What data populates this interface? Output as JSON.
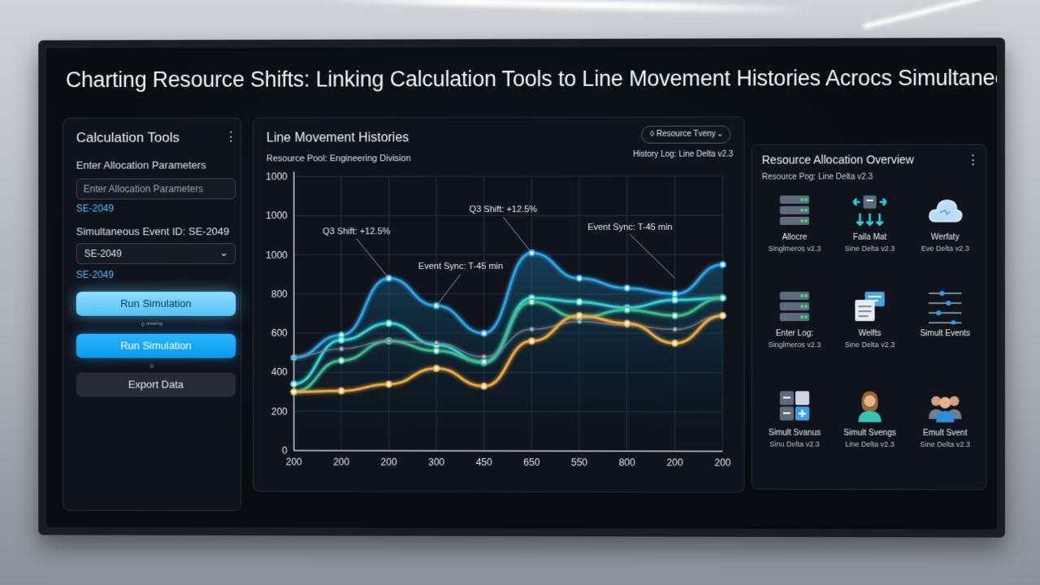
{
  "page_title": "Charting Resource Shifts: Linking Calculation Tools to Line Movement Histories Acrocs Simultaneous E.",
  "left_panel": {
    "title": "Calculation Tools",
    "alloc_label": "Enter Allocation Parameters",
    "alloc_placeholder": "Enter Allocation Parameters",
    "alloc_value": "SE-2049",
    "event_label": "Simultaneous Event ID: SE-2049",
    "event_select": "SE-2049",
    "event_value": "SE-2049",
    "run_primary": "Run Simulation",
    "tiny_caption": "◊ ᵒʳᵉᵃᵗⁱⁿᵍ",
    "run_secondary": "Run Simulation",
    "tiny_mark": "◊",
    "export": "Export Data"
  },
  "center_panel": {
    "title": "Line Movement Histories",
    "subtitle": "Resource Pool: Engineering Division",
    "dropdown": "◊ Resource Tveny",
    "history_log": "History Log: Line Delta v2.3"
  },
  "chart_data": {
    "type": "line",
    "x_tick_labels": [
      "200",
      "200",
      "200",
      "300",
      "450",
      "650",
      "550",
      "800",
      "200",
      "200"
    ],
    "y_tick_labels": [
      "0",
      "200",
      "400",
      "600",
      "800",
      "1000",
      "1000",
      "1000"
    ],
    "y_ticks": [
      0,
      200,
      400,
      600,
      800,
      1000,
      1200,
      1400
    ],
    "ylim": [
      0,
      1400
    ],
    "grid": true,
    "series": [
      {
        "color": "#2aa5ec",
        "values": [
          475,
          590,
          880,
          740,
          600,
          1010,
          880,
          830,
          800,
          950
        ]
      },
      {
        "color": "#2fd4d6",
        "values": [
          340,
          565,
          650,
          540,
          450,
          780,
          760,
          730,
          770,
          780
        ]
      },
      {
        "color": "#3dbd8f",
        "values": [
          300,
          460,
          560,
          510,
          455,
          760,
          680,
          720,
          690,
          780
        ]
      },
      {
        "color": "#7d8aa0",
        "values": [
          480,
          520,
          560,
          550,
          480,
          620,
          660,
          640,
          620,
          690
        ]
      },
      {
        "color": "#f2a93b",
        "values": [
          300,
          305,
          340,
          420,
          330,
          560,
          690,
          650,
          550,
          690
        ]
      }
    ],
    "annotations": [
      {
        "text": "Q3 Shift: +12.5%",
        "x_index": 2,
        "y": 880
      },
      {
        "text": "Event Sync: T-45 min",
        "x_index": 3,
        "y": 740
      },
      {
        "text": "Q3 Shift: +12.5%",
        "x_index": 5,
        "y": 1010
      },
      {
        "text": "Event Sync: T-45 min",
        "x_index": 8,
        "y": 880
      }
    ]
  },
  "right_panel": {
    "title": "Resource Allocation Overview",
    "subtitle": "Resource Pog: Line Delta v2.3",
    "tiles": [
      {
        "icon": "server-rack-icon",
        "label": "Allocre",
        "sub": "Singlmeros v2.3"
      },
      {
        "icon": "network-arrows-icon",
        "label": "Faila Mat",
        "sub": "Sine Delta v2.3"
      },
      {
        "icon": "cloud-icon",
        "label": "Werfaty",
        "sub": "Eve Delta v2.3"
      },
      {
        "icon": "server-rack-icon",
        "label": "Enter Log:",
        "sub": "Singlmeros v2.3"
      },
      {
        "icon": "documents-icon",
        "label": "Welfts",
        "sub": "Sine Delta v2.3"
      },
      {
        "icon": "sliders-icon",
        "label": "Simult Events",
        "sub": ""
      },
      {
        "icon": "calculator-icon",
        "label": "Simult Svanus",
        "sub": "Sinu Delta v2.3"
      },
      {
        "icon": "person-icon",
        "label": "Simult Svengs",
        "sub": "Line Delta v2.3"
      },
      {
        "icon": "team-icon",
        "label": "Emult Svent",
        "sub": "Sine Delta v2.3"
      }
    ]
  },
  "colors": {
    "accent": "#4fc3ff",
    "button_primary": "#56c2f6",
    "button_secondary": "#0a9aeb",
    "series_blue": "#2aa5ec",
    "series_cyan": "#2fd4d6",
    "series_orange": "#f2a93b"
  }
}
